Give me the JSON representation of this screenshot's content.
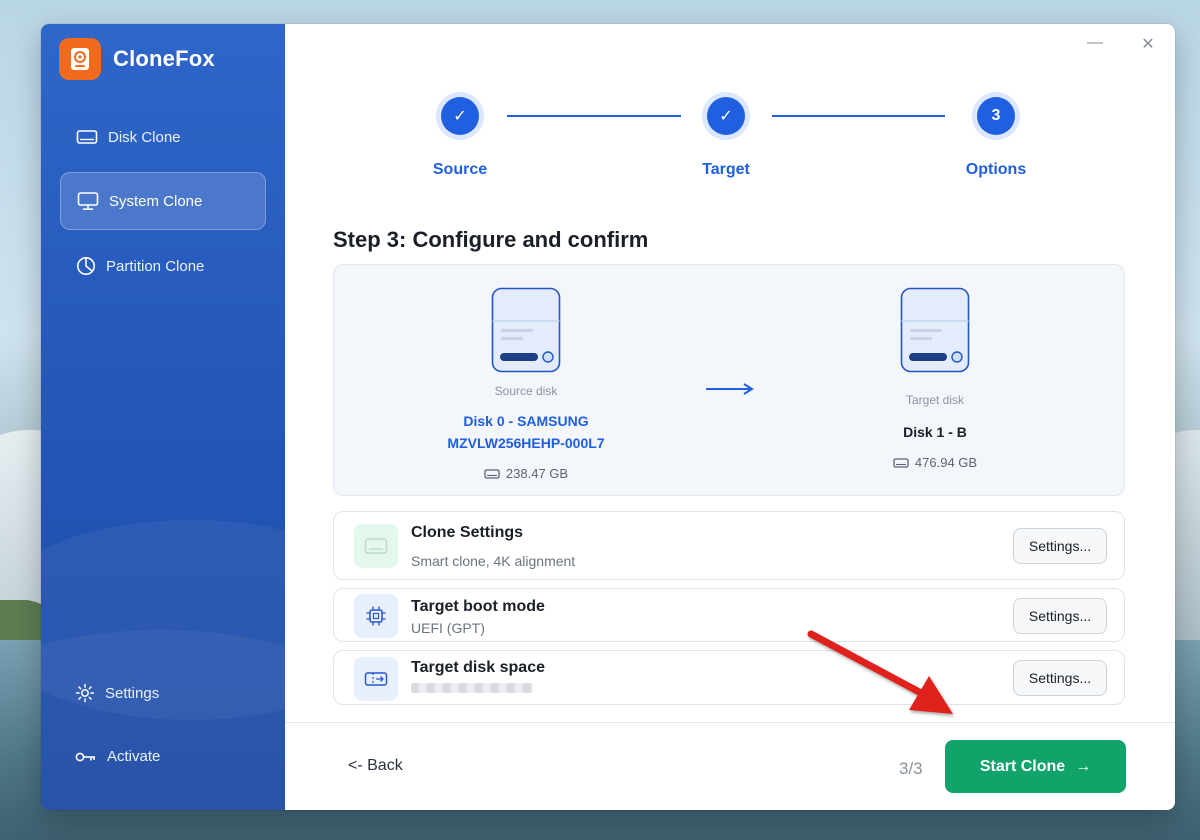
{
  "app": {
    "name": "CloneFox",
    "logo_icon": "disk-gear-logo"
  },
  "window_controls": {
    "minimize": "—",
    "close": "✕"
  },
  "sidebar": {
    "items": [
      {
        "label": "Disk Clone",
        "icon": "disk-icon",
        "active": false
      },
      {
        "label": "System Clone",
        "icon": "monitor-icon",
        "active": true
      },
      {
        "label": "Partition Clone",
        "icon": "pie-chart-icon",
        "active": false
      }
    ],
    "bottom": [
      {
        "label": "Settings",
        "icon": "gear-icon"
      },
      {
        "label": "Activate",
        "icon": "key-icon"
      }
    ]
  },
  "stepper": {
    "steps": [
      {
        "label": "Source",
        "state": "done",
        "mark": "✓"
      },
      {
        "label": "Target",
        "state": "done",
        "mark": "✓"
      },
      {
        "label": "Options",
        "state": "current",
        "mark": "3"
      }
    ]
  },
  "page_title": "Step 3: Configure and confirm",
  "source_disk": {
    "caption": "Source disk",
    "name_line1": "Disk 0 - SAMSUNG",
    "name_line2": "MZVLW256HEHP-000L7",
    "size": "238.47 GB"
  },
  "target_disk": {
    "caption": "Target disk",
    "name": "Disk 1 - B",
    "size": "476.94 GB"
  },
  "options": [
    {
      "title": "Clone Settings",
      "subtitle": "Smart clone, 4K alignment",
      "button": "Settings...",
      "icon": "drive-icon"
    },
    {
      "title": "Target boot mode",
      "subtitle": "UEFI (GPT)",
      "button": "Settings...",
      "icon": "chip-icon"
    },
    {
      "title": "Target disk space",
      "subtitle": "",
      "button": "Settings...",
      "icon": "resize-icon"
    }
  ],
  "footer": {
    "back": "<- Back",
    "counter": "3/3",
    "start": "Start Clone",
    "start_arrow": "→"
  },
  "colors": {
    "accent": "#1f5fe0",
    "sidebar": "#2357b8",
    "primary_button": "#12a36b",
    "annotation_arrow": "#e0201a"
  }
}
